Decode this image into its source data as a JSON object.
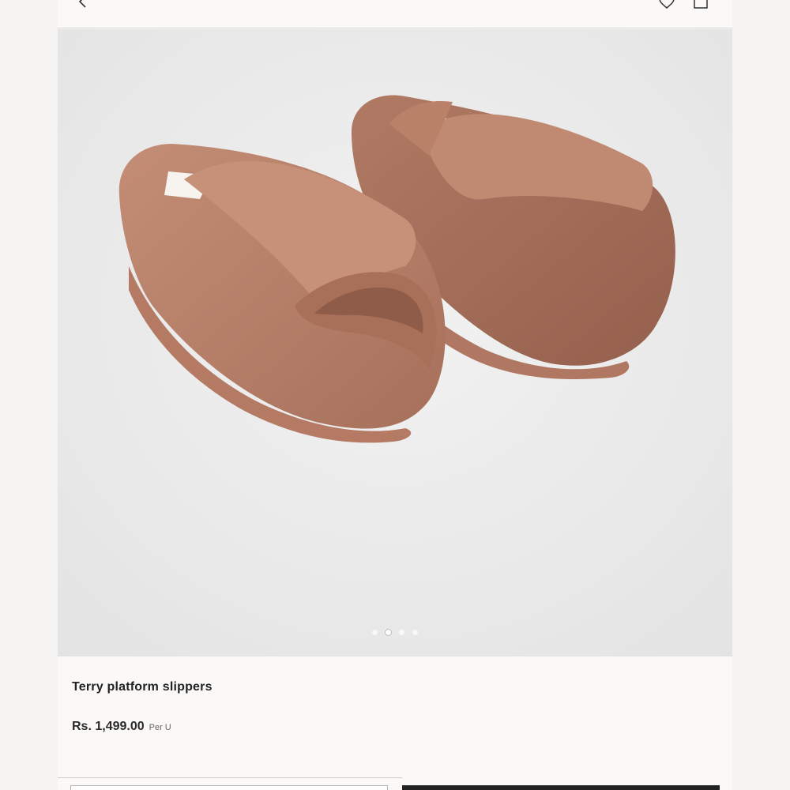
{
  "header": {
    "back_icon": "chevron-left-icon",
    "favorite_icon": "heart-icon",
    "bag_icon": "shopping-bag-icon"
  },
  "gallery": {
    "image": "terry-platform-slippers-photo",
    "image_count": 4,
    "active_index": 1,
    "colors": {
      "slipper": "#b9826b",
      "background": "#eaeaea"
    }
  },
  "product": {
    "name": "Terry platform slippers",
    "price": "Rs. 1,499.00",
    "price_unit": "Per U"
  }
}
